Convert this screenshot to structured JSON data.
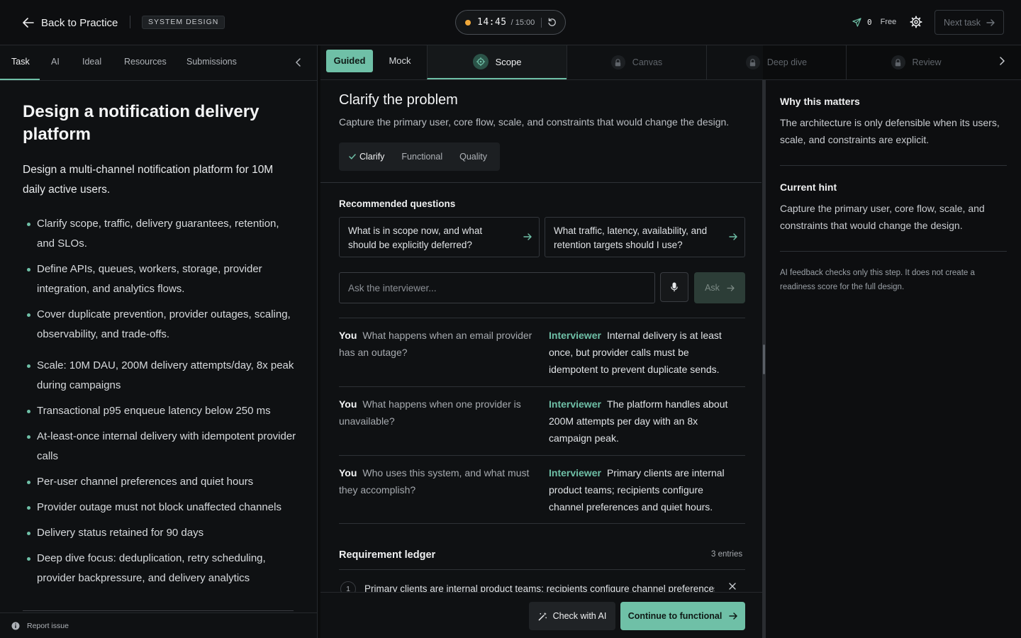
{
  "topbar": {
    "back_label": "Back to Practice",
    "badge": "SYSTEM DESIGN",
    "timer_time": "14:45",
    "timer_total": "/ 15:00",
    "credits_count": "0",
    "credits_label": "Free",
    "next_task": "Next task"
  },
  "left": {
    "tabs": [
      "Task",
      "AI",
      "Ideal",
      "Resources",
      "Submissions"
    ],
    "title": "Design a notification delivery platform",
    "intro": "Design a multi-channel notification platform for 10M daily active users.",
    "requirements": [
      "Clarify scope, traffic, delivery guarantees, retention, and SLOs.",
      "Define APIs, queues, workers, storage, provider integration, and analytics flows.",
      "Cover duplicate prevention, provider outages, scaling, observability, and trade-offs.",
      "Scale: 10M DAU, 200M delivery attempts/day, 8x peak during campaigns",
      "Transactional p95 enqueue latency below 250 ms",
      "At-least-once internal delivery with idempotent provider calls",
      "Per-user channel preferences and quiet hours",
      "Provider outage must not block unaffected channels",
      "Delivery status retained for 90 days",
      "Deep dive focus: deduplication, retry scheduling, provider backpressure, and delivery analytics"
    ],
    "report_label": "Report issue"
  },
  "mid": {
    "mode_guided": "Guided",
    "mode_mock": "Mock",
    "steps": [
      "Scope",
      "Canvas",
      "Deep dive",
      "Review"
    ],
    "title": "Clarify the problem",
    "subtitle": "Capture the primary user, core flow, scale, and constraints that would change the design.",
    "substeps": [
      "Clarify",
      "Functional",
      "Quality"
    ],
    "recommended_label": "Recommended questions",
    "recommended": [
      "What is in scope now, and what should be explicitly deferred?",
      "What traffic, latency, availability, and retention targets should I use?"
    ],
    "ask_placeholder": "Ask the interviewer...",
    "ask_button": "Ask",
    "you_label": "You",
    "interviewer_label": "Interviewer",
    "conversation": [
      {
        "you": "What happens when an email provider has an outage?",
        "interviewer": "Internal delivery is at least once, but provider calls must be idempotent to prevent duplicate sends."
      },
      {
        "you": "What happens when one provider is unavailable?",
        "interviewer": "The platform handles about 200M attempts per day with an 8x campaign peak."
      },
      {
        "you": "Who uses this system, and what must they accomplish?",
        "interviewer": "Primary clients are internal product teams; recipients configure channel preferences and quiet hours."
      }
    ],
    "ledger_title": "Requirement ledger",
    "ledger_count": "3 entries",
    "ledger_entries": [
      {
        "num": "1",
        "text": "Primary clients are internal product teams; recipients configure channel preferences and quiet hours."
      }
    ],
    "check_ai": "Check with AI",
    "continue": "Continue to functional"
  },
  "right": {
    "why_title": "Why this matters",
    "why_text": "The architecture is only defensible when its users, scale, and constraints are explicit.",
    "hint_title": "Current hint",
    "hint_text": "Capture the primary user, core flow, scale, and constraints that would change the design.",
    "note": "AI feedback checks only this step. It does not create a readiness score for the full design."
  },
  "colors": {
    "accent": "#6fc0a7",
    "timer_dot": "#f0a83a",
    "background": "#0b0c0d"
  },
  "icons": [
    "arrow-left-icon",
    "refresh-icon",
    "send-icon",
    "gear-icon",
    "arrow-right-icon",
    "chevron-left-icon",
    "chevron-right-icon",
    "target-icon",
    "lock-icon",
    "check-icon",
    "microphone-icon",
    "close-icon",
    "sparkle-wand-icon",
    "info-icon"
  ]
}
